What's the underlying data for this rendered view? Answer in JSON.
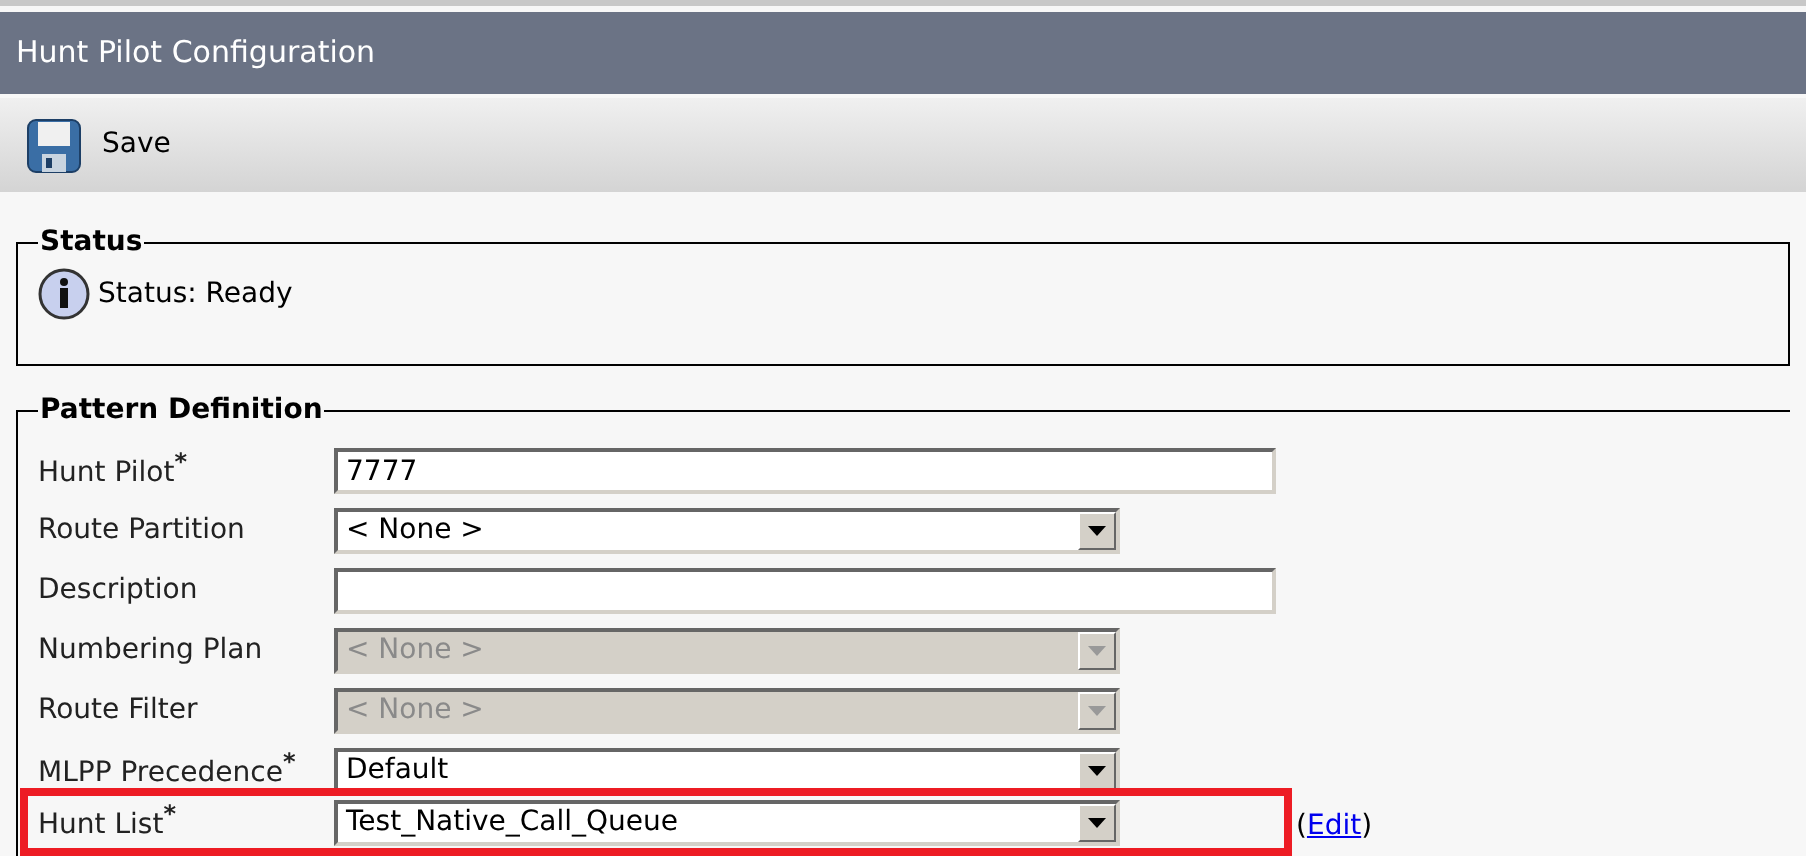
{
  "window": {
    "title": "Hunt Pilot Configuration"
  },
  "toolbar": {
    "buttons": [
      {
        "label": "Save"
      }
    ]
  },
  "status": {
    "legend": "Status",
    "message": "Status: Ready"
  },
  "pattern_definition": {
    "legend": "Pattern Definition",
    "fields": [
      {
        "label": "Hunt Pilot",
        "required_marker": "*",
        "kind": "text",
        "value": "7777",
        "disabled": false,
        "highlighted": false
      },
      {
        "label": "Route Partition",
        "kind": "select",
        "value": "< None >",
        "disabled": false,
        "highlighted": false
      },
      {
        "label": "Description",
        "kind": "text",
        "disabled": false,
        "highlighted": false
      },
      {
        "label": "Numbering Plan",
        "kind": "select",
        "value": "< None >",
        "disabled": true,
        "highlighted": false
      },
      {
        "label": "Route Filter",
        "kind": "select",
        "value": "< None >",
        "disabled": true,
        "highlighted": false
      },
      {
        "label": "MLPP Precedence",
        "required_marker": "*",
        "kind": "select",
        "value": "Default",
        "disabled": false,
        "highlighted": false
      },
      {
        "label": "Hunt List",
        "required_marker": "*",
        "kind": "select",
        "value": "Test_Native_Call_Queue",
        "disabled": false,
        "highlighted": true,
        "link": {
          "open": "(",
          "label": "Edit",
          "close": ")"
        }
      }
    ]
  }
}
